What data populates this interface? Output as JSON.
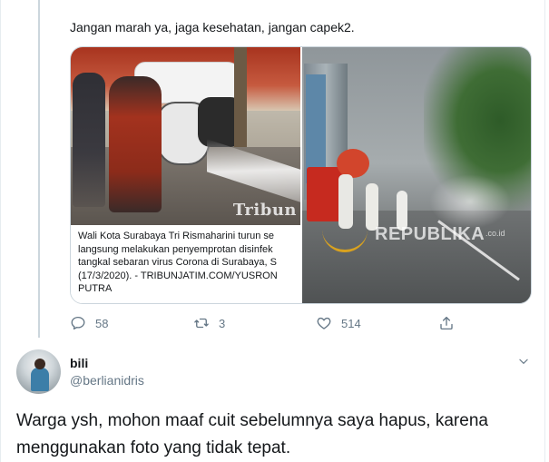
{
  "tweet": {
    "text": "Jangan marah ya, jaga kesehatan, jangan capek2.",
    "media": {
      "left_photo": {
        "watermark": "Tribun",
        "caption": "Wali Kota Surabaya Tri Rismaharini turun se\nlangsung melakukan penyemprotan disinfek\ntangkal sebaran virus Corona di Surabaya, S\n(17/3/2020). - TRIBUNJATIM.COM/YUSRON\nPUTRA"
      },
      "right_photo": {
        "watermark": "REPUBLIKA",
        "watermark_sub": ".co.id"
      }
    },
    "actions": {
      "reply_count": "58",
      "retweet_count": "3",
      "like_count": "514"
    }
  },
  "reply": {
    "user": {
      "name": "bili",
      "handle": "@berlianidris"
    },
    "text": "Warga ysh, mohon maaf cuit sebelumnya saya hapus, karena menggunakan foto yang tidak tepat."
  },
  "icons": {
    "reply": "reply-icon",
    "retweet": "retweet-icon",
    "like": "heart-icon",
    "share": "share-icon",
    "more": "chevron-down-icon"
  },
  "colors": {
    "text": "#14171a",
    "secondary": "#657786",
    "border": "#ccd6dd"
  }
}
